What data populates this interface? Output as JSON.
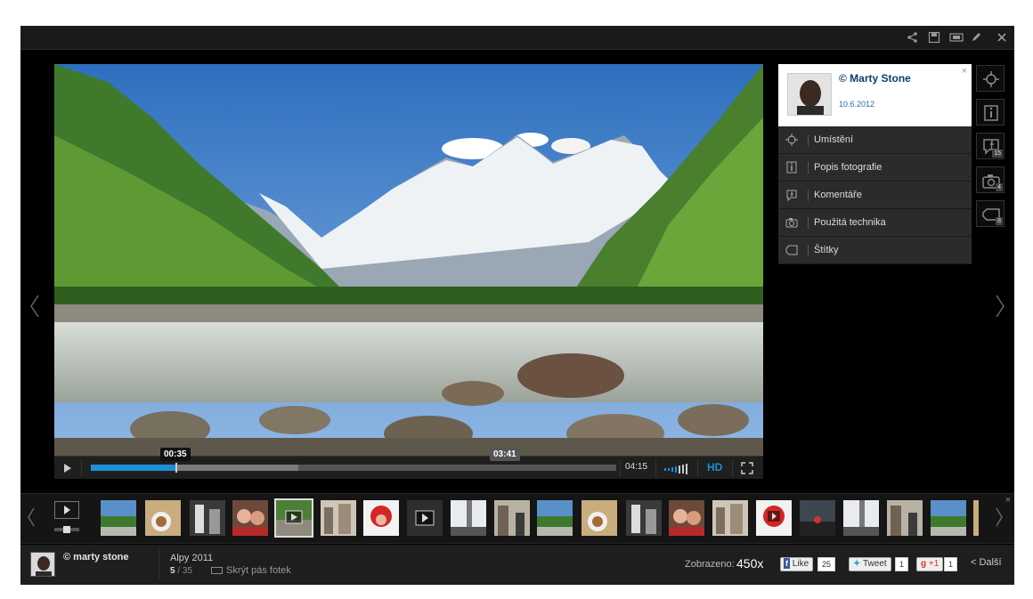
{
  "colors": {
    "accent": "#1e8fd8",
    "author_name": "#0e3f6e",
    "background": "#000000"
  },
  "player": {
    "current_time": "00:35",
    "hover_time": "03:41",
    "total_time": "04:15",
    "hd_label": "HD",
    "played_fraction": 0.162,
    "buffered_fraction": 0.395
  },
  "author": {
    "name": "© Marty Stone",
    "date": "10.6.2012",
    "close_icon": "×"
  },
  "menu": {
    "items": [
      {
        "label": "Umístění",
        "icon": "crosshair-icon"
      },
      {
        "label": "Popis fotografie",
        "icon": "info-icon"
      },
      {
        "label": "Komentáře",
        "icon": "facebook-comment-icon"
      },
      {
        "label": "Použitá technika",
        "icon": "camera-icon"
      },
      {
        "label": "Štítky",
        "icon": "tag-icon"
      }
    ]
  },
  "side_icons": [
    {
      "name": "location-side-icon",
      "badge": ""
    },
    {
      "name": "info-side-icon",
      "badge": ""
    },
    {
      "name": "comments-side-icon",
      "badge": "15"
    },
    {
      "name": "camera-side-icon",
      "badge": "4"
    },
    {
      "name": "tags-side-icon",
      "badge": "8"
    }
  ],
  "filmstrip": {
    "close_icon": "×"
  },
  "bottom": {
    "user": "© marty stone",
    "album": "Alpy 2011",
    "position_current": "5",
    "position_total": "/ 35",
    "hide_strip": "Skrýt pás fotek",
    "views_label": "Zobrazeno:",
    "views_value": "450x",
    "fb_like": "Like",
    "fb_count": "25",
    "tweet": "Tweet",
    "tweet_count": "1",
    "gplus": "+1",
    "gplus_count": "1",
    "next": "Další"
  }
}
